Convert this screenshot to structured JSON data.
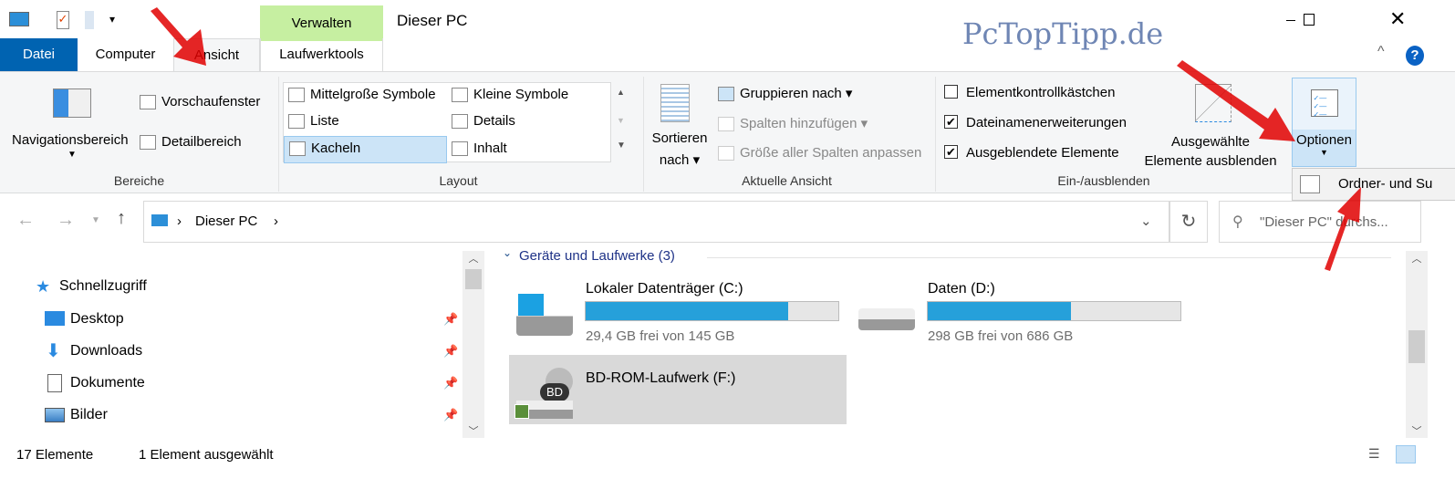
{
  "title": "Dieser PC",
  "watermark": "PcTopTipp.de",
  "tabs": {
    "datei": "Datei",
    "computer": "Computer",
    "ansicht": "Ansicht",
    "context_group": "Verwalten",
    "laufwerktools": "Laufwerktools"
  },
  "ribbon": {
    "bereiche": {
      "label": "Bereiche",
      "nav": "Navigationsbereich",
      "preview": "Vorschaufenster",
      "details": "Detailbereich"
    },
    "layout": {
      "label": "Layout",
      "items": [
        "Mittelgroße Symbole",
        "Kleine Symbole",
        "Liste",
        "Details",
        "Kacheln",
        "Inhalt"
      ],
      "selected": "Kacheln"
    },
    "ansicht": {
      "label": "Aktuelle Ansicht",
      "sort1": "Sortieren",
      "sort2": "nach",
      "group": "Gruppieren nach",
      "addcols": "Spalten hinzufügen",
      "fitcols": "Größe aller Spalten anpassen"
    },
    "einaus": {
      "label": "Ein-/ausblenden",
      "cb1": "Elementkontrollkästchen",
      "cb1_checked": false,
      "cb2": "Dateinamenerweiterungen",
      "cb2_checked": true,
      "cb3": "Ausgeblendete Elemente",
      "cb3_checked": true,
      "hide1": "Ausgewählte",
      "hide2": "Elemente ausblenden"
    },
    "optionen": "Optionen",
    "dropdown_item": "Ordner- und Su"
  },
  "address": {
    "path": "Dieser PC",
    "search_placeholder": "\"Dieser PC\" durchs..."
  },
  "sidebar": {
    "quick": "Schnellzugriff",
    "items": [
      "Desktop",
      "Downloads",
      "Dokumente",
      "Bilder"
    ]
  },
  "content": {
    "group": "Geräte und Laufwerke (3)",
    "drives": [
      {
        "name": "Lokaler Datenträger (C:)",
        "free": "29,4 GB frei von 145 GB",
        "used_pct": 80
      },
      {
        "name": "Daten (D:)",
        "free": "298 GB frei von 686 GB",
        "used_pct": 56.6
      },
      {
        "name": "BD-ROM-Laufwerk (F:)",
        "badge": "BD"
      }
    ]
  },
  "status": {
    "count": "17 Elemente",
    "selected": "1 Element ausgewählt"
  },
  "colors": {
    "accent": "#0063b1",
    "context": "#c6efa1",
    "bar": "#26a0da",
    "arrow": "#e00000"
  }
}
